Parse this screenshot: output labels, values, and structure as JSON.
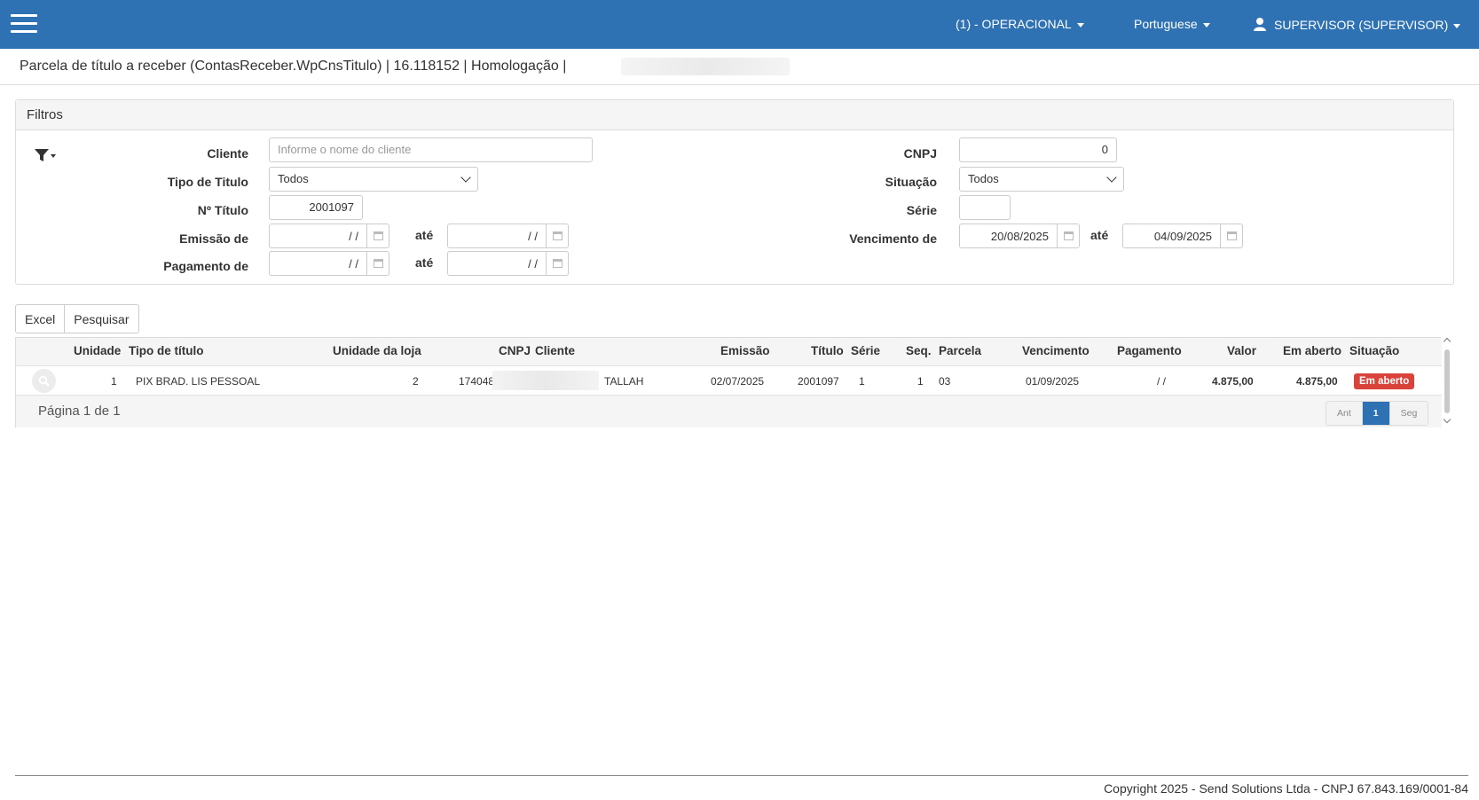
{
  "navbar": {
    "unit": "(1) - OPERACIONAL",
    "language": "Portuguese",
    "user": "SUPERVISOR (SUPERVISOR)",
    "color": "#2e72b3"
  },
  "header": {
    "title": "Parcela de título a receber (ContasReceber.WpCnsTitulo) | 16.118152 | Homologação |"
  },
  "filters": {
    "heading": "Filtros",
    "cliente_label": "Cliente",
    "cliente_placeholder": "Informe o nome do cliente",
    "tipo_label": "Tipo de Titulo",
    "tipo_value": "Todos",
    "numero_label": "Nº Título",
    "numero_value": "2001097",
    "emissao_label": "Emissão de",
    "emissao_de": "/ /",
    "emissao_ate": "/ /",
    "pagamento_label": "Pagamento de",
    "pagamento_de": "/ /",
    "pagamento_ate": "/ /",
    "ate_label": "até",
    "cnpj_label": "CNPJ",
    "cnpj_value": "0",
    "situacao_label": "Situação",
    "situacao_value": "Todos",
    "serie_label": "Série",
    "serie_value": "",
    "vencimento_label": "Vencimento de",
    "vencimento_de": "20/08/2025",
    "vencimento_ate": "04/09/2025"
  },
  "actions": {
    "excel": "Excel",
    "pesquisar": "Pesquisar"
  },
  "grid": {
    "columns": {
      "unidade": "Unidade",
      "tipo": "Tipo de título",
      "unidade_loja": "Unidade da loja",
      "cnpj": "CNPJ",
      "cliente": "Cliente",
      "emissao": "Emissão",
      "titulo": "Título",
      "serie": "Série",
      "seq": "Seq.",
      "parcela": "Parcela",
      "vencimento": "Vencimento",
      "pagamento": "Pagamento",
      "valor": "Valor",
      "em_aberto": "Em aberto",
      "situacao": "Situação"
    },
    "rows": [
      {
        "unidade": "1",
        "tipo": "PIX BRAD. LIS PESSOAL",
        "unidade_loja": "2",
        "cnpj": "174048",
        "cliente": "TALLAH",
        "emissao": "02/07/2025",
        "titulo": "2001097",
        "serie": "1",
        "seq": "1",
        "parcela": "03",
        "vencimento": "01/09/2025",
        "pagamento": "/ /",
        "valor": "4.875,00",
        "em_aberto": "4.875,00",
        "situacao": "Em aberto",
        "situacao_color": "#d9433a"
      }
    ],
    "page_info": "Página 1 de 1",
    "pager": {
      "prev": "Ant",
      "current": "1",
      "next": "Seg"
    }
  },
  "footer": {
    "copyright": "Copyright 2025 - Send Solutions Ltda - CNPJ 67.843.169/0001-84"
  }
}
